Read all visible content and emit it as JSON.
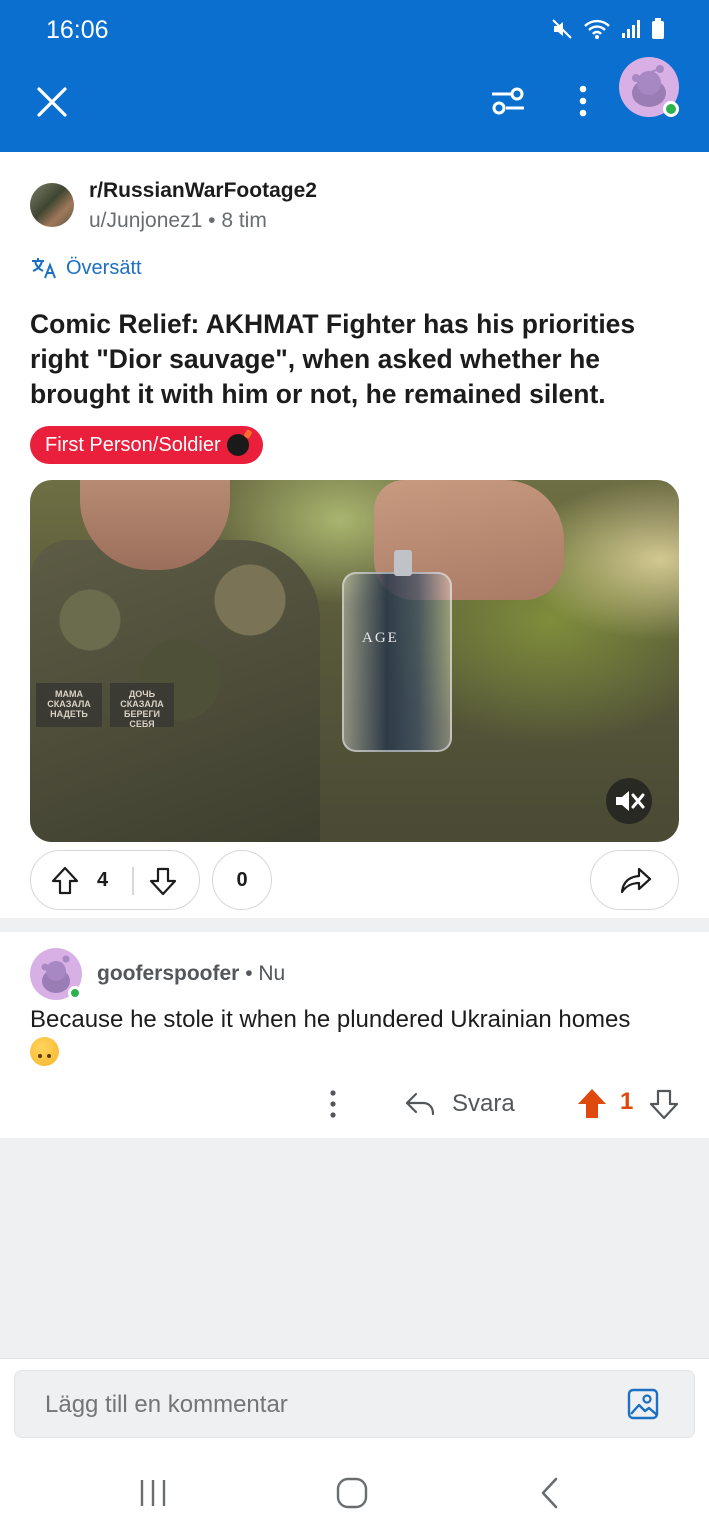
{
  "status_bar": {
    "time": "16:06",
    "icons": [
      "mute-icon",
      "wifi-icon",
      "signal-icon",
      "battery-icon"
    ]
  },
  "header": {
    "close_icon": "close-icon",
    "filter_icon": "sort-filter-icon",
    "more_icon": "more-vertical-icon",
    "avatar": "user-avatar",
    "background": "#0a6fcf"
  },
  "post": {
    "subreddit": "r/RussianWarFootage2",
    "author": "u/Junjonez1",
    "age": "8 tim",
    "meta_separator": "•",
    "translate_label": "Översätt",
    "title": "Comic Relief: AKHMAT Fighter has his priorities right \"Dior sauvage\", when asked whether he brought it with him or not, he remained silent.",
    "flair": "First Person/Soldier",
    "flair_color": "#ea1f3c",
    "video": {
      "patch_left": "МАМА СКАЗАЛА НАДЕТЬ",
      "patch_right": "ДОЧЬ СКАЗАЛА БЕРЕГИ СЕБЯ",
      "bottle_text": "AGE",
      "muted": true
    },
    "votes": "4",
    "comments": "0"
  },
  "comment": {
    "author": "gooferspoofer",
    "separator": "•",
    "age": "Nu",
    "body": "Because he stole it when he plundered Ukrainian homes",
    "emoji": "upside-down-face",
    "reply_label": "Svara",
    "score": "1",
    "upvote_color": "#e0490d"
  },
  "composer": {
    "placeholder": "Lägg till en kommentar"
  }
}
